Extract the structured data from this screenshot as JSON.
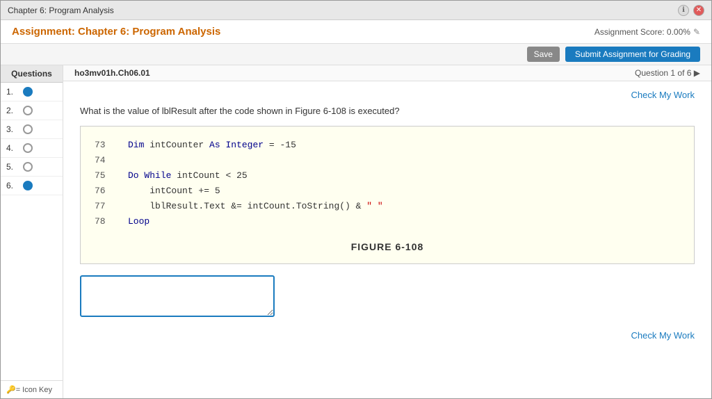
{
  "window": {
    "title": "Chapter 6: Program Analysis"
  },
  "header": {
    "assignment_title": "Assignment: Chapter 6: Program Analysis",
    "score_label": "Assignment Score: 0.00%",
    "edit_icon": "✎"
  },
  "toolbar": {
    "save_label": "Save",
    "submit_label": "Submit Assignment for Grading"
  },
  "sidebar": {
    "header": "Questions",
    "items": [
      {
        "number": "1.",
        "filled": true
      },
      {
        "number": "2.",
        "filled": false
      },
      {
        "number": "3.",
        "filled": false
      },
      {
        "number": "4.",
        "filled": false
      },
      {
        "number": "5.",
        "filled": false
      },
      {
        "number": "6.",
        "filled": true
      }
    ],
    "footer": "🔑= Icon Key"
  },
  "content_header": {
    "tab_label": "ho3mv01h.Ch06.01",
    "question_nav": "Question 1 of 6 ▶"
  },
  "check_work_top": "Check My Work",
  "check_work_bottom": "Check My Work",
  "question": {
    "text": "What is the value of lblResult after the code shown in Figure 6-108 is executed?"
  },
  "figure": {
    "lines": [
      {
        "num": "73",
        "code": "    Dim intCounter As Integer = -15"
      },
      {
        "num": "74",
        "code": ""
      },
      {
        "num": "75",
        "code": "    Do While intCount < 25"
      },
      {
        "num": "76",
        "code": "        intCount += 5"
      },
      {
        "num": "77",
        "code": "        lblResult.Text &= intCount.ToString() & \" \""
      },
      {
        "num": "78",
        "code": "    Loop"
      }
    ],
    "caption": "FIGURE 6-108"
  },
  "answer": {
    "placeholder": ""
  }
}
